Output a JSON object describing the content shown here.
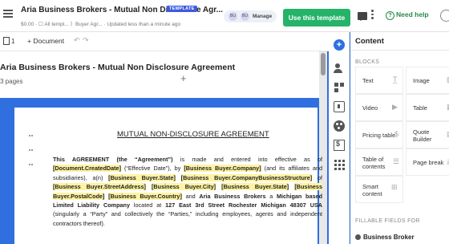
{
  "window": {
    "title": "Aria Business Brokers - Mutual Non Disclosure Agr...",
    "badge": "TEMPLATE",
    "subtitle": "$0.00 · ☐ All templ... 〉Buyer Agr... · Updated less than a minute ago"
  },
  "header": {
    "avatar1": "BU",
    "avatar2": "BU",
    "manage": "Manage",
    "use_template": "Use this template",
    "need_help": "Need help",
    "help_symbol": "?"
  },
  "toolbar": {
    "pages_count": "1",
    "add_document": "+ Document",
    "undo": "↶",
    "redo": "↷"
  },
  "document": {
    "name": "Aria Business Brokers - Mutual Non Disclosure Agreement",
    "pages": "3 pages",
    "plus": "+",
    "heading": "MUTUAL NON-DISCLOSURE AGREEMENT",
    "paragraph": {
      "t1": "This AGREEMENT (the “Agreement”)",
      "t2": " is made and entered into effective as of ",
      "f1": "[Document.CreatedDate]",
      "t3": " (“Effective Date”), by ",
      "f2": "[Business Buyer.Company]",
      "t4": " (and its affiliates and subsidiaries), a(n) ",
      "f3": "[Business Buyer.State]",
      "t5": " ",
      "f4": "[Business Buyer.CompanyBusinessStructure]",
      "t6": " of ",
      "f5": "[Business Buyer.StreetAddress]",
      "t7": " ",
      "f6": "[Business Buyer.City]",
      "t8": " ",
      "f7": "[Business Buyer.State]",
      "t9": " ",
      "f8": "[Business Buyer.PostalCode]",
      "t10": " ",
      "f9": "[Business Buyer.Country]",
      "t11": " and ",
      "t12": "Aria Business Brokers",
      "t13": " a ",
      "t14": "Michigan based Limited Liability Company",
      "t15": " located at ",
      "t16": "127 East 3rd Street Rochester Michigan 48307 USA",
      "t17": " (singularly a “Party” and collectively the “Parties,” including employees, agents and independent contractors thereof)."
    }
  },
  "panel": {
    "title": "Content",
    "blocks_header": "BLOCKS",
    "blocks": [
      {
        "label": "Text",
        "icon": "text-icon"
      },
      {
        "label": "Image",
        "icon": "image-icon"
      },
      {
        "label": "Video",
        "icon": "video-icon"
      },
      {
        "label": "Table",
        "icon": "table-icon"
      },
      {
        "label": "Pricing table",
        "icon": "pricing-table-icon"
      },
      {
        "label": "Quote Builder",
        "icon": "quote-builder-icon"
      },
      {
        "label": "Table of contents",
        "icon": "toc-icon"
      },
      {
        "label": "Page break",
        "icon": "page-break-icon"
      },
      {
        "label": "Smart content",
        "icon": "smart-content-icon"
      }
    ],
    "fillable_header": "FILLABLE FIELDS FOR",
    "fillable_role": "Business Broker"
  },
  "colors": {
    "accent": "#2f6fe0",
    "primary_button": "#25b36a",
    "field_highlight": "#fff3a3",
    "badge": "#3d5ae0"
  }
}
